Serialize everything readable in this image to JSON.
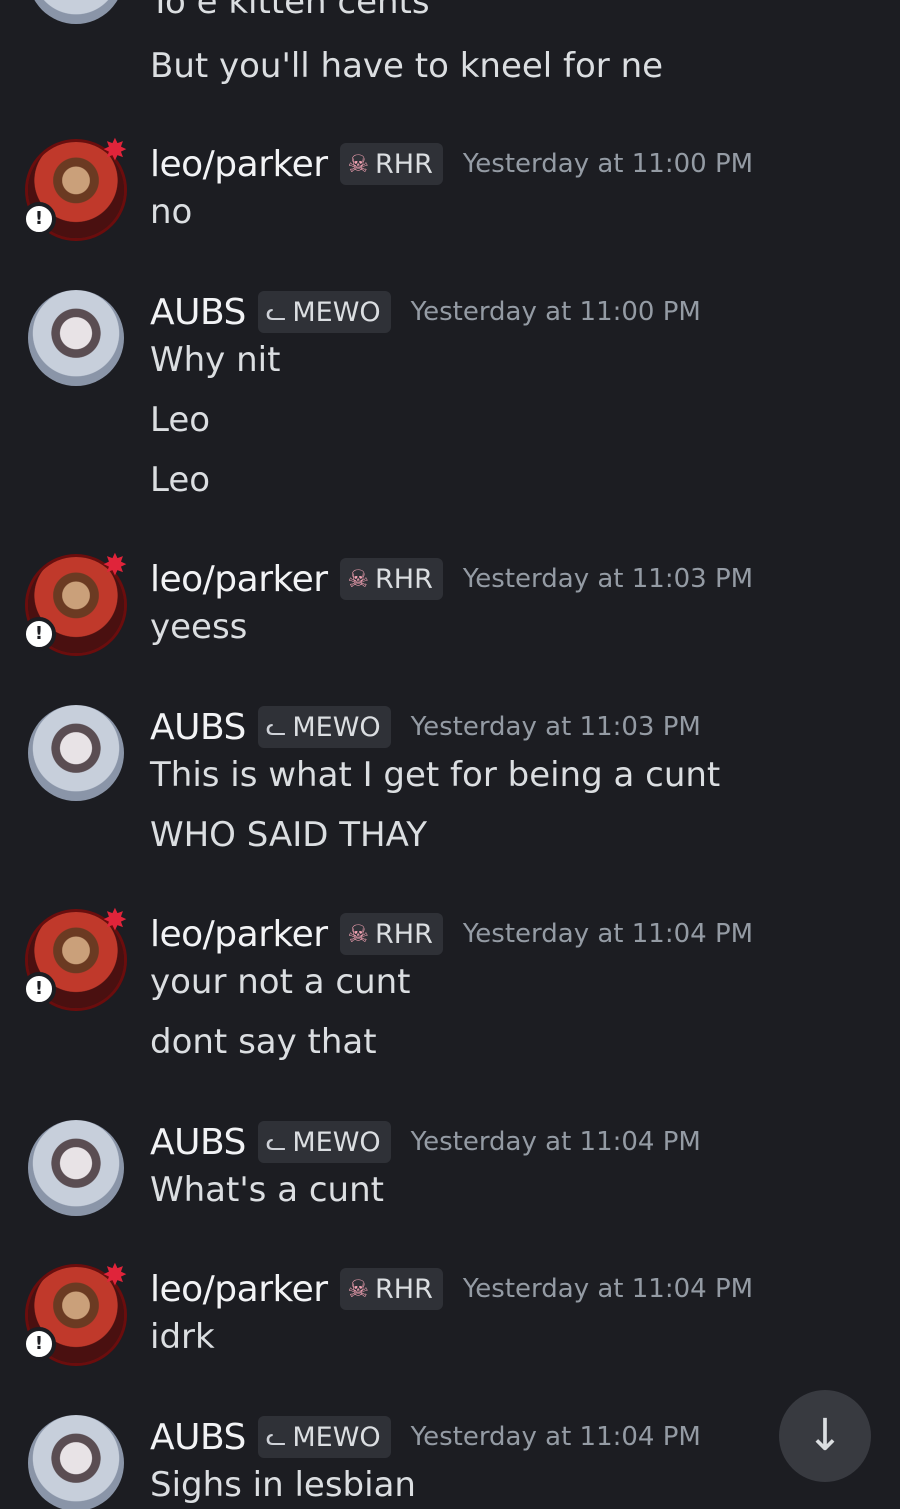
{
  "partial_top": {
    "cut_line": "To e kitten cents",
    "line": "But you'll have to kneel for ne"
  },
  "messages": [
    {
      "author": "leo/parker",
      "tag": "RHR",
      "tag_icon": "skull-icon",
      "timestamp": "Yesterday at 11:00 PM",
      "lines": [
        "no"
      ]
    },
    {
      "author": "AUBS",
      "tag": "MEWO",
      "tag_icon": "cat-icon",
      "timestamp": "Yesterday at 11:00 PM",
      "lines": [
        "Why nit",
        "Leo",
        "Leo"
      ]
    },
    {
      "author": "leo/parker",
      "tag": "RHR",
      "tag_icon": "skull-icon",
      "timestamp": "Yesterday at 11:03 PM",
      "lines": [
        "yeess"
      ]
    },
    {
      "author": "AUBS",
      "tag": "MEWO",
      "tag_icon": "cat-icon",
      "timestamp": "Yesterday at 11:03 PM",
      "lines": [
        "This is what I get for being a cunt",
        "WHO SAID THAY"
      ]
    },
    {
      "author": "leo/parker",
      "tag": "RHR",
      "tag_icon": "skull-icon",
      "timestamp": "Yesterday at 11:04 PM",
      "lines": [
        "your not a cunt",
        "dont say that"
      ]
    },
    {
      "author": "AUBS",
      "tag": "MEWO",
      "tag_icon": "cat-icon",
      "timestamp": "Yesterday at 11:04 PM",
      "lines": [
        "What's a cunt"
      ]
    },
    {
      "author": "leo/parker",
      "tag": "RHR",
      "tag_icon": "skull-icon",
      "timestamp": "Yesterday at 11:04 PM",
      "lines": [
        "idrk"
      ]
    },
    {
      "author": "AUBS",
      "tag": "MEWO",
      "tag_icon": "cat-icon",
      "timestamp": "Yesterday at 11:04 PM",
      "lines": [
        "Sighs in lesbian"
      ]
    }
  ],
  "scroll_button": {
    "icon": "arrow-down-icon"
  },
  "colors": {
    "background": "#1c1d22",
    "username": "#f2f3f5",
    "timestamp": "#949ba4",
    "tag_bg": "#2f3137"
  }
}
